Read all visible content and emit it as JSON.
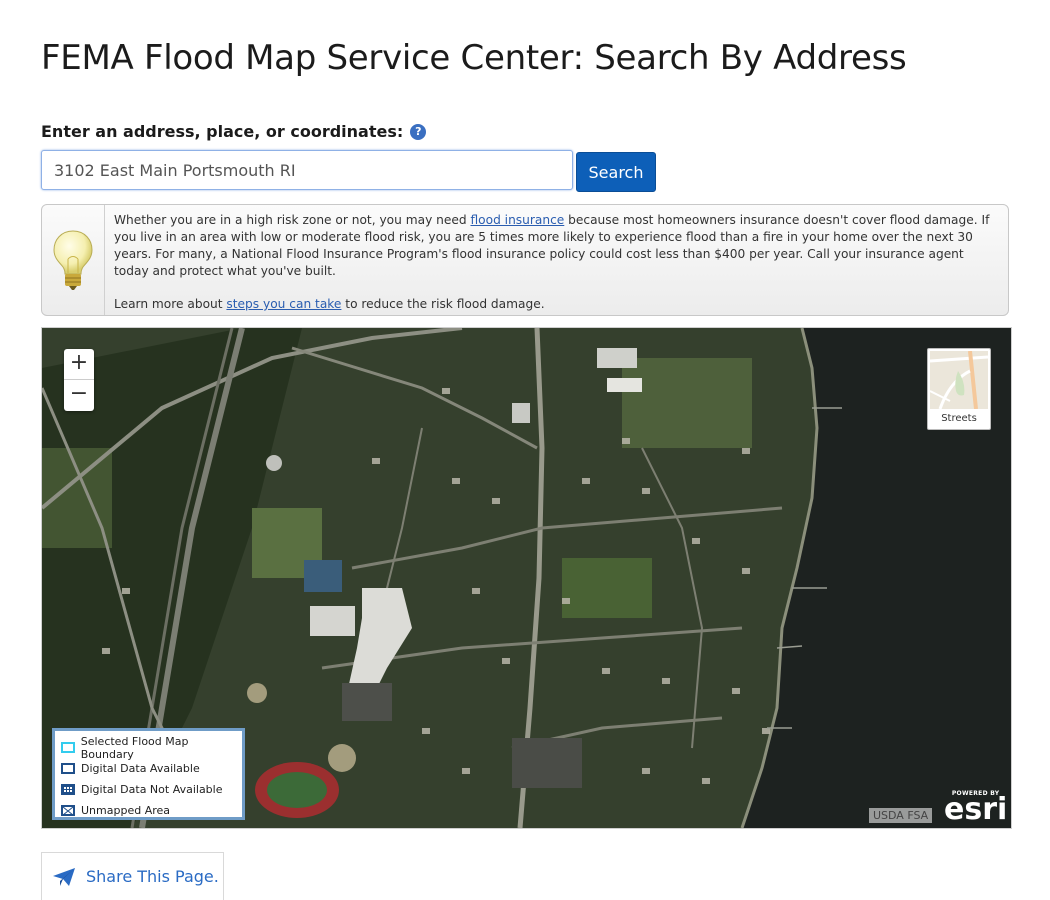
{
  "page": {
    "title": "FEMA Flood Map Service Center: Search By Address"
  },
  "search": {
    "label": "Enter an address, place, or coordinates:",
    "help_icon": "?",
    "value": "3102 East Main Portsmouth RI",
    "button_label": "Search"
  },
  "info": {
    "icon": "lightbulb-icon",
    "p1_before": "Whether you are in a high risk zone or not, you may need ",
    "p1_link": "flood insurance",
    "p1_after": " because most homeowners insurance doesn't cover flood damage. If you live in an area with low or moderate flood risk, you are 5 times more likely to experience flood than a fire in your home over the next 30 years. For many, a National Flood Insurance Program's flood insurance policy could cost less than $400 per year. Call your insurance agent today and protect what you've built.",
    "p2_before": "Learn more about ",
    "p2_link": "steps you can take",
    "p2_after": " to reduce the risk flood damage."
  },
  "map": {
    "zoom_in": "+",
    "zoom_out": "−",
    "basemap_label": "Streets",
    "legend": [
      {
        "label": "Selected Flood Map Boundary",
        "color": "#33ccee"
      },
      {
        "label": "Digital Data Available",
        "color": "#1f4f8a"
      },
      {
        "label": "Digital Data Not Available",
        "color": "#1f4f8a"
      },
      {
        "label": "Unmapped Area",
        "color": "#1f4f8a"
      }
    ],
    "attribution": "USDA FSA",
    "esri_powered": "POWERED BY",
    "esri_logo": "esri"
  },
  "share": {
    "label": "Share This Page.",
    "icon": "paper-plane-icon"
  }
}
